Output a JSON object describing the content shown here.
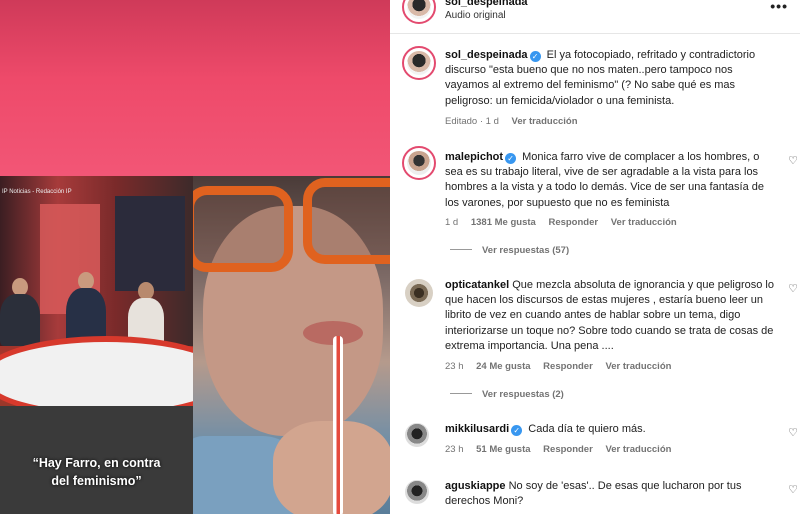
{
  "video": {
    "tv_label": "IP Noticias - Redacción IP",
    "caption_line1": "“Hay Farro, en contra",
    "caption_line2": "del feminismo”"
  },
  "header": {
    "username": "sol_despeinada",
    "audio_label": "Audio original",
    "more_icon": "•••"
  },
  "comments": [
    {
      "username": "sol_despeinada",
      "verified": true,
      "text": "El ya fotocopiado, refritado y contradictorio discurso \"esta bueno que no nos maten..pero tampoco nos vayamos al extremo del feminismo\" (? No sabe qué es mas peligroso: un femicida/violador o una feminista.",
      "time": "Editado · 1 d",
      "translate": "Ver traducción"
    },
    {
      "username": "malepichot",
      "verified": true,
      "text": "Monica farro vive de complacer a los hombres, o sea es su trabajo literal, vive de ser agradable a la vista para los hombres a la vista y a todo lo demás. Vice de ser una fantasía de los varones, por supuesto que no es feminista",
      "time": "1 d",
      "likes": "1381 Me gusta",
      "reply": "Responder",
      "translate": "Ver traducción",
      "view_replies": "Ver respuestas (57)"
    },
    {
      "username": "opticatankel",
      "verified": false,
      "text": "Que mezcla absoluta de ignorancia y que peligroso lo que hacen los discursos de estas mujeres , estaría bueno leer un librito de vez en cuando antes de hablar sobre un tema, digo interiorizarse un toque no? Sobre todo cuando se trata de cosas de extrema importancia. Una pena ....",
      "time": "23 h",
      "likes": "24 Me gusta",
      "reply": "Responder",
      "translate": "Ver traducción",
      "view_replies": "Ver respuestas (2)"
    },
    {
      "username": "mikkilusardi",
      "verified": true,
      "text": "Cada día te quiero más.",
      "time": "23 h",
      "likes": "51 Me gusta",
      "reply": "Responder",
      "translate": "Ver traducción"
    },
    {
      "username": "aguskiappe",
      "verified": false,
      "text": "No soy de 'esas'.. De esas que lucharon por tus derechos Moni?"
    }
  ],
  "icons": {
    "heart": "♡",
    "verified": "✓"
  }
}
